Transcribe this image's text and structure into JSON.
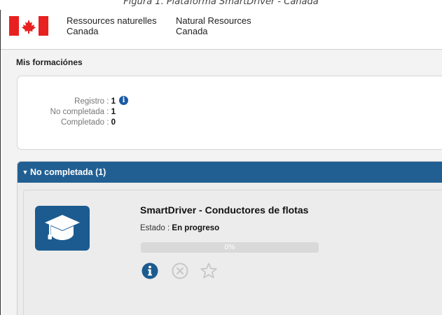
{
  "caption": "Figura 1. Plataforma SmartDriver - Canadá",
  "header": {
    "org_fr_line1": "Ressources naturelles",
    "org_fr_line2": "Canada",
    "org_en_line1": "Natural Resources",
    "org_en_line2": "Canada",
    "flag_icon": "canada-flag-icon",
    "colors": {
      "flag_red": "#e8201f"
    }
  },
  "page": {
    "title": "Mis formaciónes",
    "summary": {
      "registro_label": "Registro :",
      "registro_value": "1",
      "no_completada_label": "No completada :",
      "no_completada_value": "1",
      "completado_label": "Completado :",
      "completado_value": "0"
    }
  },
  "panel": {
    "header_label": "No completada (1)",
    "header_color": "#215f93",
    "course": {
      "icon": "graduation-cap-icon",
      "title": "SmartDriver - Conductores de flotas",
      "state_label": "Estado :",
      "state_value": "En progreso",
      "progress_percent": 0,
      "progress_text": "0%",
      "actions": [
        "info-icon",
        "remove-icon",
        "favorite-star-icon"
      ]
    }
  }
}
